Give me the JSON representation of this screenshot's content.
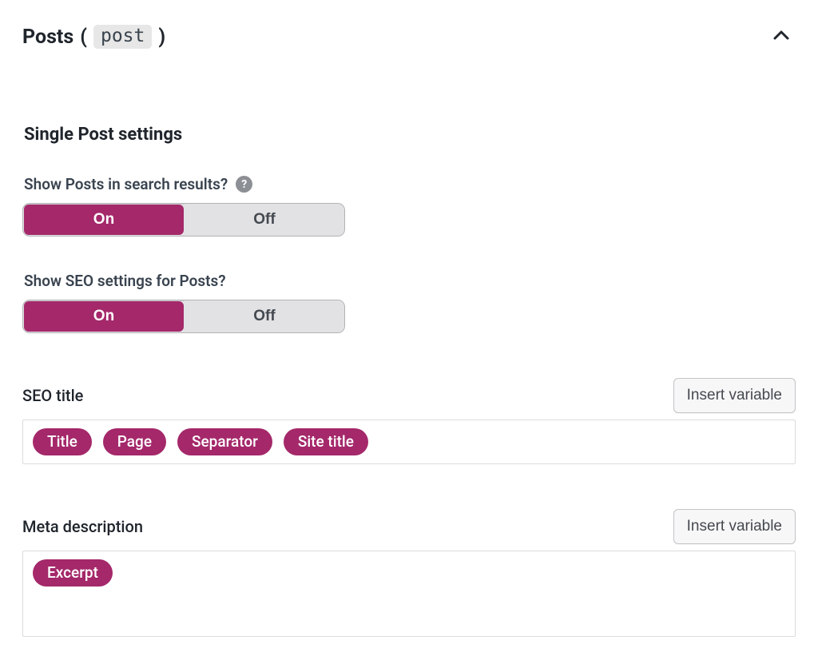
{
  "section": {
    "title_prefix": "Posts",
    "paren_open": "(",
    "code": "post",
    "paren_close": ")",
    "collapsed": false
  },
  "subsection": {
    "heading": "Single Post settings"
  },
  "toggles": {
    "search_results": {
      "label": "Show Posts in search results?",
      "has_help": true,
      "on_label": "On",
      "off_label": "Off",
      "value": "On"
    },
    "seo_settings": {
      "label": "Show SEO settings for Posts?",
      "has_help": false,
      "on_label": "On",
      "off_label": "Off",
      "value": "On"
    }
  },
  "fields": {
    "seo_title": {
      "label": "SEO title",
      "insert_button": "Insert variable",
      "chips": [
        "Title",
        "Page",
        "Separator",
        "Site title"
      ]
    },
    "meta_description": {
      "label": "Meta description",
      "insert_button": "Insert variable",
      "chips": [
        "Excerpt"
      ]
    }
  }
}
